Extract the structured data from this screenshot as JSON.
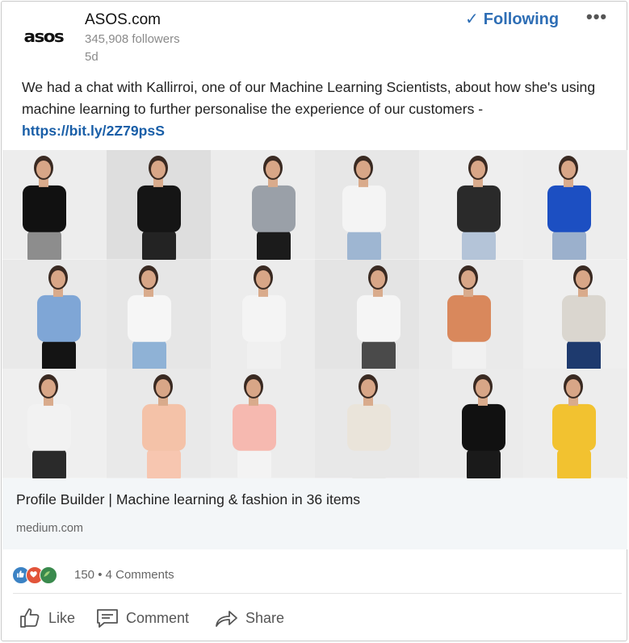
{
  "post": {
    "company": "ASOS.com",
    "logo_text": "asos",
    "followers": "345,908 followers",
    "time": "5d",
    "follow_label": "Following",
    "more_label": "•••",
    "text": "We had a chat with Kallirroi, one of our Machine Learning Scientists, about how she's using machine learning to further personalise the experience of our customers - ",
    "link": "https://bit.ly/2Z79psS"
  },
  "preview": {
    "title": "Profile Builder | Machine learning & fashion in 36 items",
    "source": "medium.com"
  },
  "social": {
    "counts": "150 • 4 Comments",
    "reactions": [
      "like-reaction",
      "love-reaction",
      "celebrate-reaction"
    ]
  },
  "actions": {
    "like": "Like",
    "comment": "Comment",
    "share": "Share"
  },
  "colors": {
    "accent": "#2e6eb5",
    "link": "#1a5fa8",
    "preview_bg": "#f3f6f8"
  },
  "grid_tiles": [
    {
      "bg": "#ededed",
      "top": "#111111",
      "bottom": "#8d8d8d"
    },
    {
      "bg": "#dedede",
      "top": "#151515",
      "bottom": "#232323"
    },
    {
      "bg": "#ececec",
      "top": "#9aa0a8",
      "bottom": "#1b1b1b"
    },
    {
      "bg": "#e7e7e7",
      "top": "#f4f4f4",
      "bottom": "#9eb6d2"
    },
    {
      "bg": "#eeeeee",
      "top": "#2a2a2a",
      "bottom": "#b4c4d8"
    },
    {
      "bg": "#ededed",
      "top": "#1c4fc2",
      "bottom": "#9bb0cc"
    },
    {
      "bg": "#e9e9e9",
      "top": "#7fa6d6",
      "bottom": "#141414"
    },
    {
      "bg": "#e6e6e6",
      "top": "#f6f6f6",
      "bottom": "#8fb2d6"
    },
    {
      "bg": "#ececec",
      "top": "#f4f4f4",
      "bottom": "#f0f0f0"
    },
    {
      "bg": "#e4e4e4",
      "top": "#f5f5f5",
      "bottom": "#4a4a4a"
    },
    {
      "bg": "#eaeaea",
      "top": "#d9885c",
      "bottom": "#f1f1f1"
    },
    {
      "bg": "#efefef",
      "top": "#dad6cf",
      "bottom": "#1e3a6e"
    },
    {
      "bg": "#efefef",
      "top": "#f2f2f2",
      "bottom": "#2a2a2a"
    },
    {
      "bg": "#e9e9e9",
      "top": "#f4c2a8",
      "bottom": "#f7c6b0"
    },
    {
      "bg": "#ececec",
      "top": "#f6b9b0",
      "bottom": "#f3f3f3"
    },
    {
      "bg": "#e8e8e8",
      "top": "#eae4da",
      "bottom": "#e8e8e8"
    },
    {
      "bg": "#ebebeb",
      "top": "#111111",
      "bottom": "#1a1a1a"
    },
    {
      "bg": "#ededed",
      "top": "#f2c230",
      "bottom": "#f2c230"
    }
  ]
}
